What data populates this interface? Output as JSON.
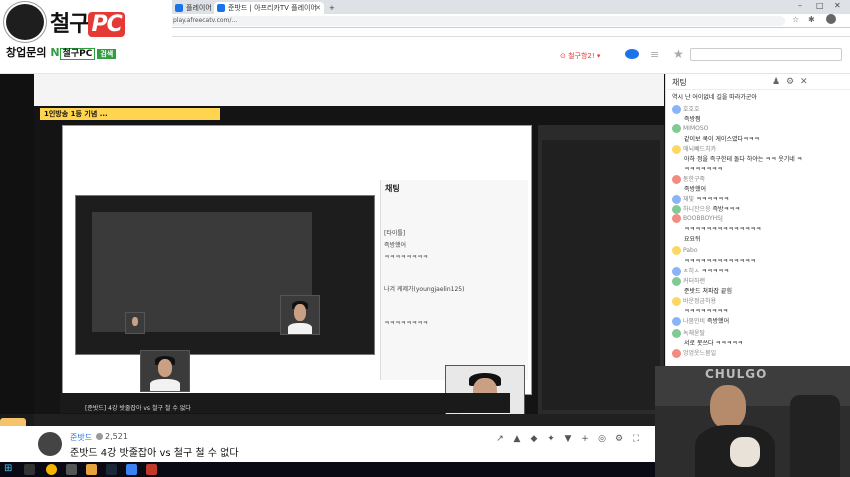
{
  "browser": {
    "tabs": [
      {
        "label": "플레이어"
      },
      {
        "label": "준밧드 | 아프리카TV 플레이어"
      }
    ],
    "url": "play.afreecatv.com/..."
  },
  "logo": {
    "main_text": "철구",
    "pc_text": "PC",
    "sub_text": "창업문의",
    "sub_n": "N",
    "sub_box": "철구PC",
    "sub_search": "검색"
  },
  "stream": {
    "inner_banner": "1인방송 1등 기념 ...",
    "inner_info_title": "[준밧드] 4강 밧줄잡아 vs 철구 철 수 없다"
  },
  "inner_chat": {
    "title": "채팅",
    "messages": [
      "[타이틀]",
      "즉방했어",
      "ㅋㅋㅋㅋㅋㅋㅋㅋ",
      "나겨 케제가(youngjaelin125)",
      "ㅋㅋㅋㅋㅋㅋㅋㅋ"
    ]
  },
  "info": {
    "streamer": "준밧드",
    "viewers": "2,521",
    "title": "준밧드 4강 밧줄잡아 vs 철구 철 수 없다"
  },
  "chat": {
    "title": "채팅",
    "messages": [
      {
        "nick": "",
        "text": "역시 난 어이없네 길을 따라가군아",
        "color": "#f28b82"
      },
      {
        "nick": "호호호",
        "text": "즉방쩜",
        "color": "#8ab4f8"
      },
      {
        "nick": "MIMOSO",
        "text": "같이보 쿡이 게이스였다ㅋㅋㅋ",
        "color": "#81c995"
      },
      {
        "nick": "애뇌빼드치카",
        "text": "아하 정을 즉구한테 돌다 하야는 ㅋㅋ 웃기네 ㅋ",
        "color": "#fdd663"
      },
      {
        "nick": "",
        "text": "ㅋㅋㅋㅋㅋㅋㅋ",
        "color": "#fdd663"
      },
      {
        "nick": "동한구죽",
        "text": "즉방했어",
        "color": "#f28b82"
      },
      {
        "nick": "재빛",
        "text": "ㅋㅋㅋㅋㅋㅋ",
        "color": "#8ab4f8"
      },
      {
        "nick": "하니잔으응",
        "text": "즉방ㅋㅋㅋ",
        "color": "#81c995"
      },
      {
        "nick": "BOOBBOYHSJ",
        "text": "ㅋㅋㅋㅋㅋㅋㅋㅋㅋㅋㅋㅋㅋㅋ",
        "color": "#f28b82"
      },
      {
        "nick": "",
        "text": "요요뒤",
        "color": "#f28b82"
      },
      {
        "nick": "Pabo",
        "text": "ㅋㅋㅋㅋㅋㅋㅋㅋㅋㅋㅋㅋㅋ",
        "color": "#fdd663"
      },
      {
        "nick": "ㅈ히ㅅ",
        "text": "ㅋㅋㅋㅋㅋ",
        "color": "#8ab4f8"
      },
      {
        "nick": "커터하랜",
        "text": "준밧드 쳐파잡 끝힘",
        "color": "#81c995"
      },
      {
        "nick": "바운정금하용",
        "text": "ㅋㅋㅋㅋㅋㅋㅋㅋ",
        "color": "#fdd663"
      },
      {
        "nick": "나뭄인비",
        "text": "즉방했어",
        "color": "#8ab4f8"
      },
      {
        "nick": "녹체윤탈",
        "text": "서로 못쓰다 ㅋㅋㅋㅋㅋ",
        "color": "#81c995"
      },
      {
        "nick": "엉엉웃느뭄일",
        "text": "ㅋㅋㅋㅋㅋㅋㅋㅋㅋㅋㅋ",
        "color": "#f28b82"
      }
    ]
  },
  "webcam": {
    "wall_text": "CHULGO"
  },
  "taskbar": {
    "start": "⊞"
  }
}
